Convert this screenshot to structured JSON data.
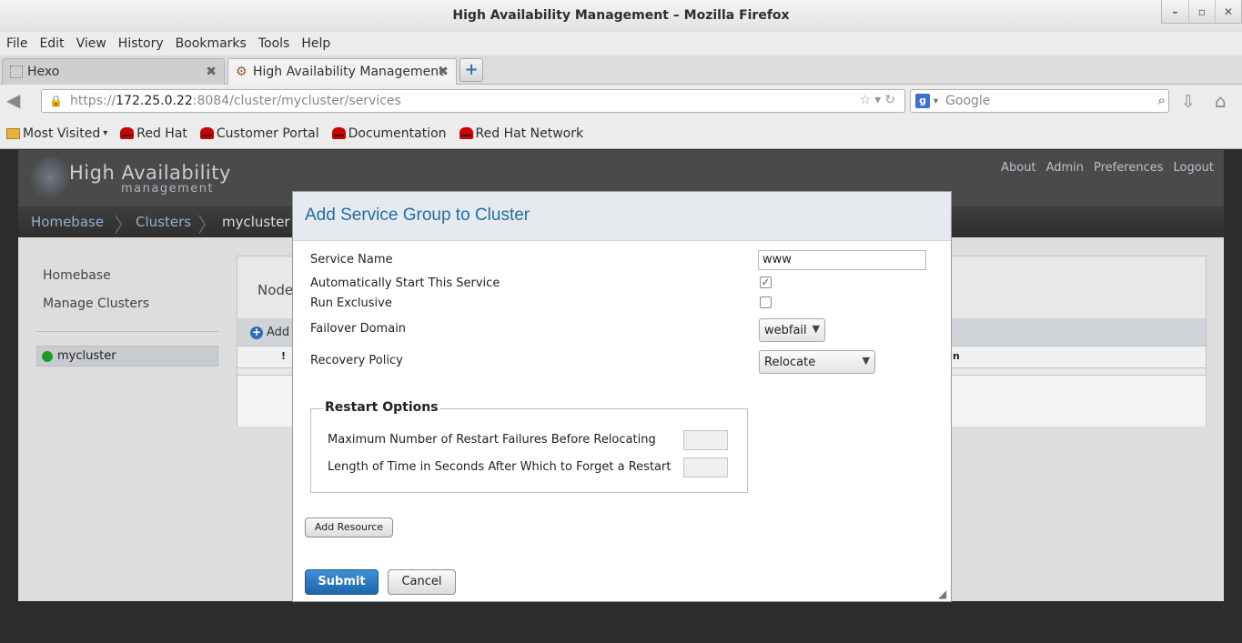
{
  "window": {
    "title": "High Availability Management – Mozilla Firefox"
  },
  "menu": [
    "File",
    "Edit",
    "View",
    "History",
    "Bookmarks",
    "Tools",
    "Help"
  ],
  "tabs": [
    {
      "label": "Hexo"
    },
    {
      "label": "High Availability Management"
    }
  ],
  "url": {
    "scheme": "https://",
    "host": "172.25.0.22",
    "rest": ":8084/cluster/mycluster/services"
  },
  "search": {
    "placeholder": "Google"
  },
  "bookmarks": [
    "Most Visited",
    "Red Hat",
    "Customer Portal",
    "Documentation",
    "Red Hat Network"
  ],
  "app": {
    "logo_title": "High Availability",
    "logo_sub": "management",
    "toplinks": [
      "About",
      "Admin",
      "Preferences",
      "Logout"
    ],
    "breadcrumb": [
      "Homebase",
      "Clusters",
      "mycluster"
    ],
    "nav": [
      "Homebase",
      "Manage Clusters"
    ],
    "cluster": "mycluster",
    "panel": {
      "nodes_label": "Node",
      "add_label": "Add",
      "col_mark": "!",
      "col_tail": "n"
    }
  },
  "dialog": {
    "title": "Add Service Group to Cluster",
    "service_name_label": "Service Name",
    "service_name_value": "www",
    "autostart_label": "Automatically Start This Service",
    "autostart_checked": true,
    "exclusive_label": "Run Exclusive",
    "exclusive_checked": false,
    "failover_label": "Failover Domain",
    "failover_value": "webfail",
    "recovery_label": "Recovery Policy",
    "recovery_value": "Relocate",
    "restart_legend": "Restart Options",
    "max_restarts_label": "Maximum Number of Restart Failures Before Relocating",
    "forget_label": "Length of Time in Seconds After Which to Forget a Restart",
    "add_resource": "Add Resource",
    "submit": "Submit",
    "cancel": "Cancel"
  }
}
